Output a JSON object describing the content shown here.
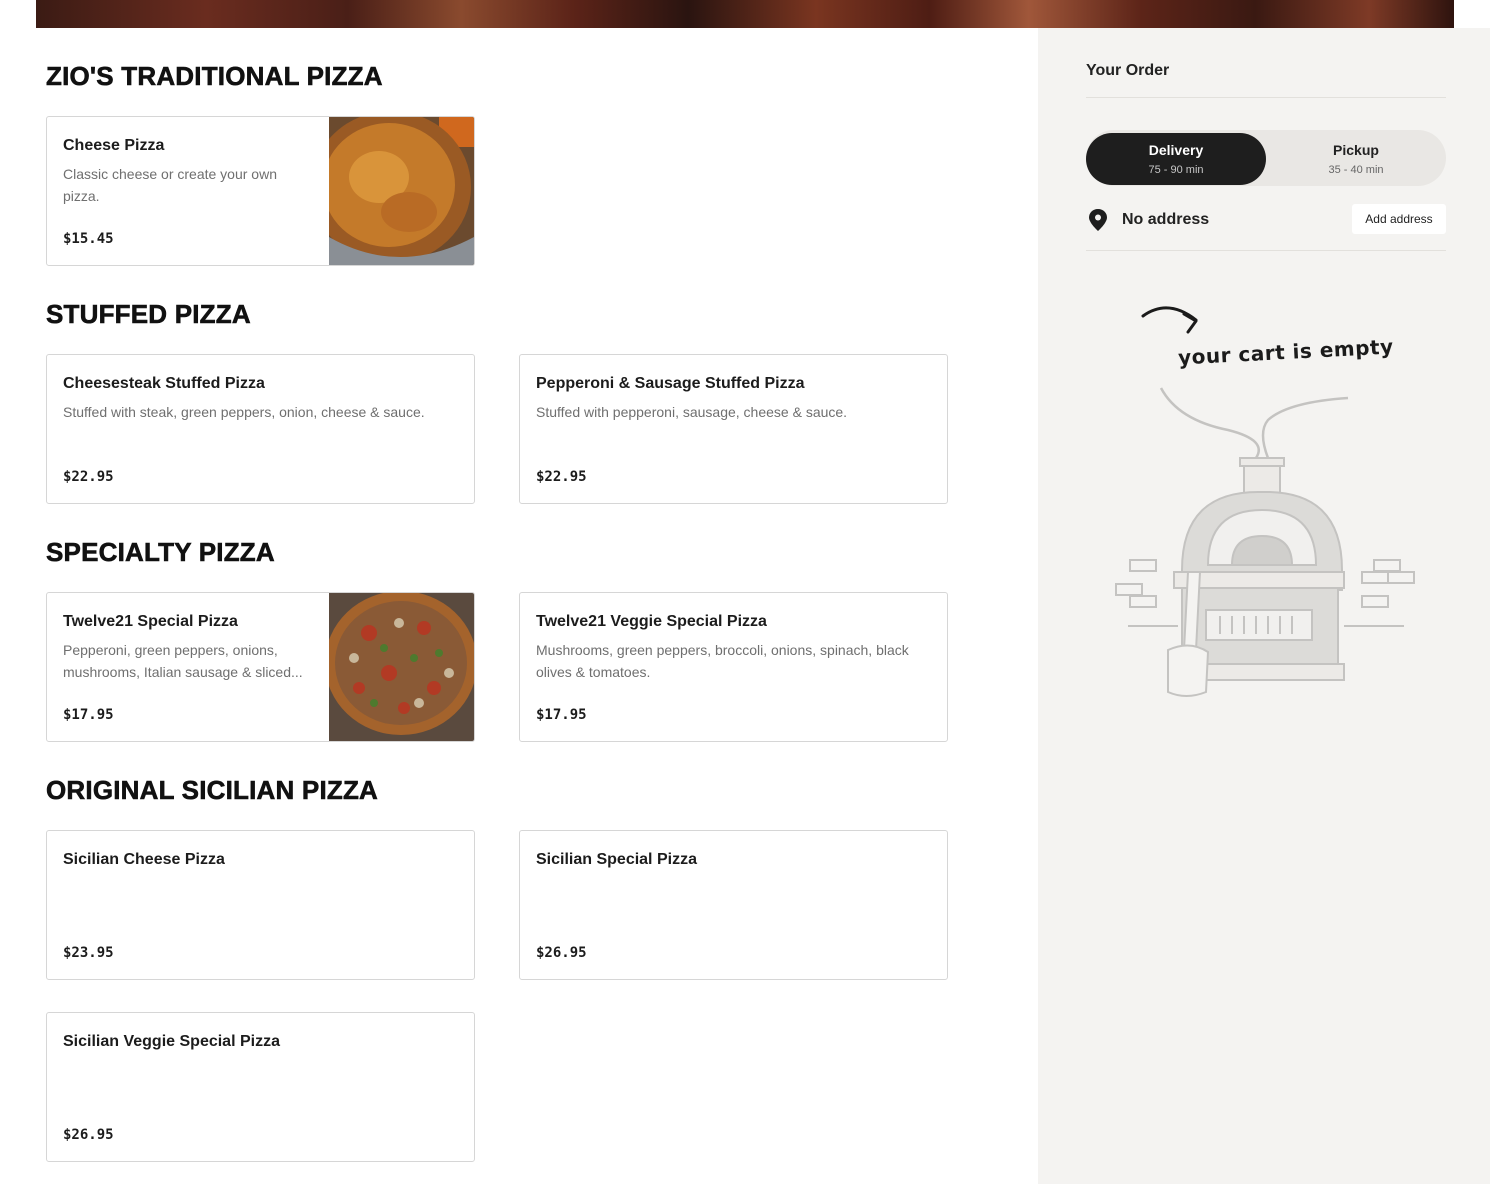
{
  "sections": [
    {
      "title": "ZIO'S TRADITIONAL PIZZA",
      "items": [
        {
          "name": "Cheese Pizza",
          "description": "Classic cheese or create your own pizza.",
          "price": "$15.45",
          "image": "cheese-pizza-photo"
        }
      ]
    },
    {
      "title": "STUFFED PIZZA",
      "items": [
        {
          "name": "Cheesesteak Stuffed Pizza",
          "description": "Stuffed with steak, green peppers, onion, cheese & sauce.",
          "price": "$22.95"
        },
        {
          "name": "Pepperoni & Sausage Stuffed Pizza",
          "description": "Stuffed with pepperoni, sausage, cheese & sauce.",
          "price": "$22.95"
        }
      ]
    },
    {
      "title": "SPECIALTY PIZZA",
      "items": [
        {
          "name": "Twelve21 Special Pizza",
          "description": "Pepperoni, green peppers, onions, mushrooms, Italian sausage & sliced...",
          "price": "$17.95",
          "image": "special-pizza-photo"
        },
        {
          "name": "Twelve21 Veggie Special Pizza",
          "description": "Mushrooms, green peppers, broccoli, onions, spinach, black olives & tomatoes.",
          "price": "$17.95"
        }
      ]
    },
    {
      "title": "ORIGINAL SICILIAN PIZZA",
      "items": [
        {
          "name": "Sicilian Cheese Pizza",
          "description": "",
          "price": "$23.95"
        },
        {
          "name": "Sicilian Special Pizza",
          "description": "",
          "price": "$26.95"
        },
        {
          "name": "Sicilian Veggie Special Pizza",
          "description": "",
          "price": "$26.95"
        }
      ]
    }
  ],
  "order": {
    "title": "Your Order",
    "delivery": {
      "label": "Delivery",
      "time": "75 - 90 min"
    },
    "pickup": {
      "label": "Pickup",
      "time": "35 - 40 min"
    },
    "address_text": "No address",
    "add_address_label": "Add address",
    "empty_message": "your cart is empty",
    "icons": {
      "address": "location-pin-icon",
      "empty": "pizza-oven-illustration"
    }
  }
}
